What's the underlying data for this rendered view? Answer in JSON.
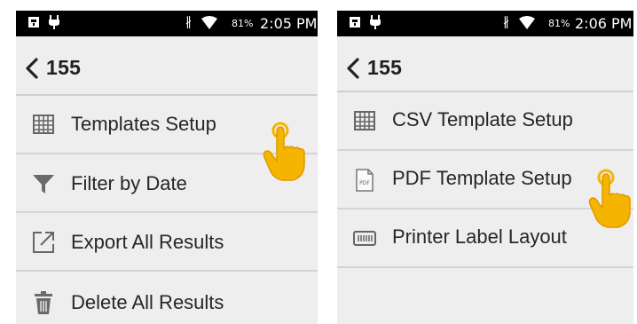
{
  "screens": [
    {
      "status": {
        "battery": "81%",
        "time": "2:05 PM"
      },
      "header": {
        "title": "155"
      },
      "menu": [
        {
          "label": "Templates Setup",
          "icon": "grid-icon"
        },
        {
          "label": "Filter by Date",
          "icon": "filter-icon"
        },
        {
          "label": "Export All Results",
          "icon": "export-icon"
        },
        {
          "label": "Delete All Results",
          "icon": "trash-icon"
        }
      ]
    },
    {
      "status": {
        "battery": "81%",
        "time": "2:06 PM"
      },
      "header": {
        "title": "155"
      },
      "menu": [
        {
          "label": "CSV Template Setup",
          "icon": "grid-icon"
        },
        {
          "label": "PDF Template Setup",
          "icon": "pdf-file-icon",
          "icon_text": "PDF"
        },
        {
          "label": "Printer Label Layout",
          "icon": "printer-label-icon"
        }
      ]
    }
  ],
  "colors": {
    "accent": "#f5b400",
    "hand_outline": "#e09a00"
  }
}
